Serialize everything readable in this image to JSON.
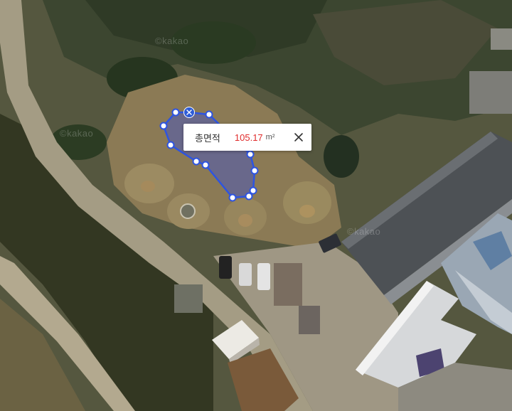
{
  "watermark": "©kakao",
  "measure": {
    "label": "총면적",
    "value": "105.17",
    "unit": "m²",
    "close_icon": "close-icon",
    "delete_icon": "close-icon"
  },
  "colors": {
    "polygon_stroke": "#2e54e0",
    "polygon_fill": "#3b4fd6",
    "value_text": "#e02b2b"
  }
}
